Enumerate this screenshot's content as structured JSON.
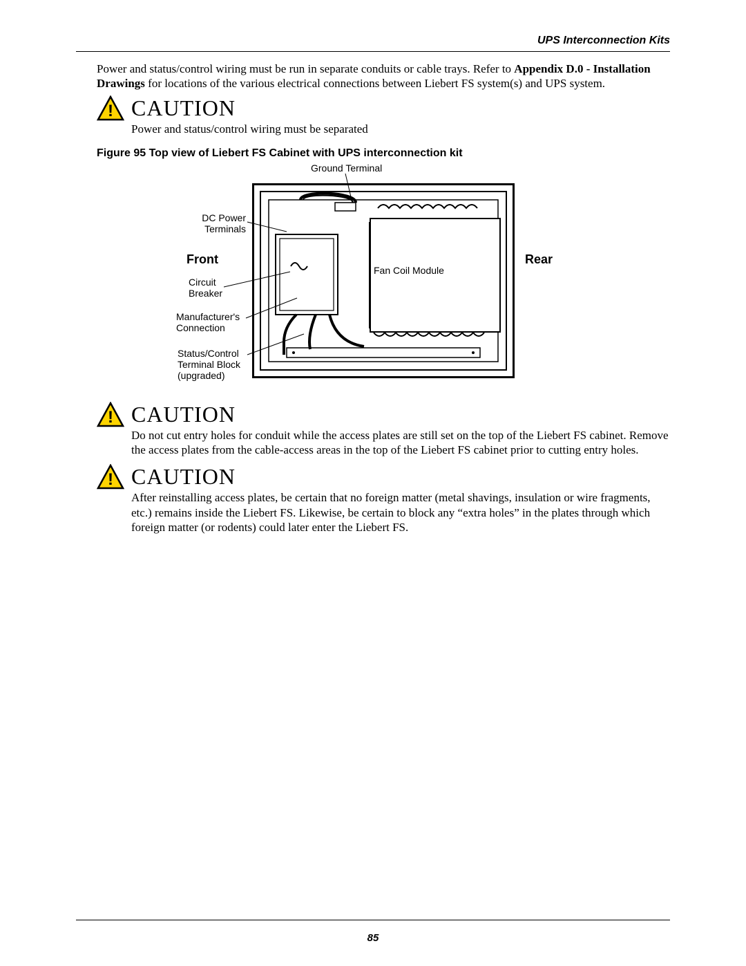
{
  "header": {
    "section_title": "UPS Interconnection Kits"
  },
  "intro": {
    "p1_run1": "Power and status/control wiring must be run in separate conduits or cable trays. Refer to ",
    "p1_bold": "Appendix D.0 - Installation Drawings",
    "p1_run2": " for locations of the various electrical connections between Liebert FS system(s) and UPS system."
  },
  "caution1": {
    "title": "CAUTION",
    "text": "Power and status/control wiring must be separated"
  },
  "figure": {
    "caption": "Figure 95  Top view of Liebert FS Cabinet with UPS interconnection kit",
    "labels": {
      "ground_terminal": "Ground Terminal",
      "dc_power_terminals": "DC Power\nTerminals",
      "front": "Front",
      "rear": "Rear",
      "circuit_breaker": "Circuit\nBreaker",
      "manufacturers_connection": "Manufacturer's\nConnection",
      "status_control_terminal_block": "Status/Control\nTerminal Block\n(upgraded)",
      "fan_coil_module": "Fan Coil Module"
    }
  },
  "caution2": {
    "title": "CAUTION",
    "text": "Do not cut entry holes for conduit while the access plates are still set on the top of the Liebert FS cabinet. Remove the access plates from the cable-access areas in the top of the Liebert FS cabinet prior to cutting entry holes."
  },
  "caution3": {
    "title": "CAUTION",
    "text": "After reinstalling access plates, be certain that no foreign matter (metal shavings, insulation or wire fragments, etc.) remains inside the Liebert FS. Likewise, be certain to block any “extra holes” in the plates through which foreign matter (or rodents) could later enter the Liebert FS."
  },
  "footer": {
    "page_number": "85"
  }
}
